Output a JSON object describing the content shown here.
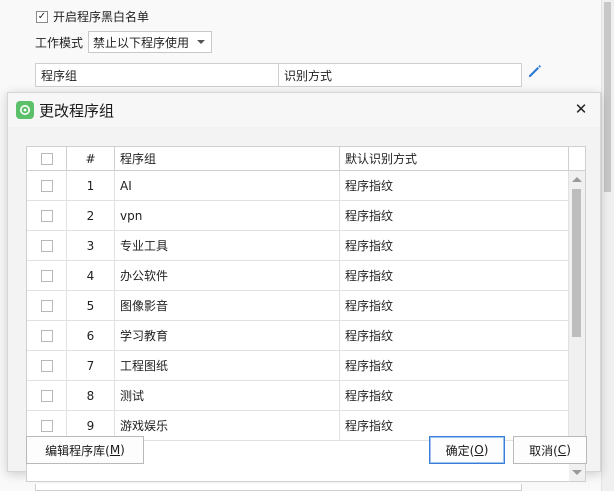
{
  "background": {
    "blacklist_checkbox_label": "开启程序黑白名单",
    "blacklist_checked": true,
    "work_mode_label": "工作模式",
    "work_mode_value": "禁止以下程序使用",
    "table_headers": [
      "程序组",
      "识别方式"
    ],
    "edit_icon": "pencil-icon"
  },
  "dialog": {
    "title": "更改程序组",
    "icon": "app-icon",
    "close_icon": "close-icon",
    "columns": [
      "#",
      "程序组",
      "默认识别方式"
    ],
    "rows": [
      {
        "num": "1",
        "group": "AI",
        "method": "程序指纹"
      },
      {
        "num": "2",
        "group": "vpn",
        "method": "程序指纹"
      },
      {
        "num": "3",
        "group": "专业工具",
        "method": "程序指纹"
      },
      {
        "num": "4",
        "group": "办公软件",
        "method": "程序指纹"
      },
      {
        "num": "5",
        "group": "图像影音",
        "method": "程序指纹"
      },
      {
        "num": "6",
        "group": "学习教育",
        "method": "程序指纹"
      },
      {
        "num": "7",
        "group": "工程图纸",
        "method": "程序指纹"
      },
      {
        "num": "8",
        "group": "测试",
        "method": "程序指纹"
      },
      {
        "num": "9",
        "group": "游戏娱乐",
        "method": "程序指纹"
      }
    ],
    "buttons": {
      "edit_library": {
        "text": "编辑程序库(",
        "hotkey": "M",
        "suffix": ")"
      },
      "ok": {
        "text": "确定(",
        "hotkey": "O",
        "suffix": ")"
      },
      "cancel": {
        "text": "取消(",
        "hotkey": "C",
        "suffix": ")"
      }
    }
  },
  "colors": {
    "accent": "#2b7bd6",
    "app_icon_green": "#5cc06a"
  }
}
